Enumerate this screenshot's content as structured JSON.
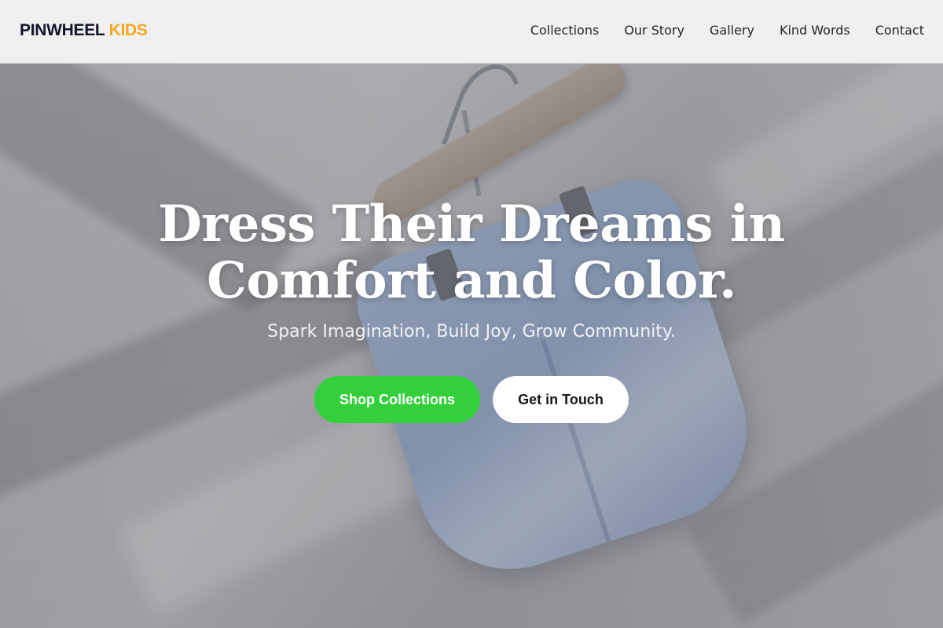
{
  "brand": {
    "name": "PINWHEEL",
    "accent": "KIDS"
  },
  "nav": {
    "items": [
      {
        "label": "Collections"
      },
      {
        "label": "Our Story"
      },
      {
        "label": "Gallery"
      },
      {
        "label": "Kind Words"
      },
      {
        "label": "Contact"
      }
    ]
  },
  "hero": {
    "headline_line1": "Dress Their Dreams in",
    "headline_line2": "Comfort and Color.",
    "subheadline": "Spark Imagination, Build Joy, Grow Community.",
    "primary_cta": "Shop Collections",
    "secondary_cta": "Get in Touch"
  },
  "colors": {
    "brand_text": "#12142a",
    "brand_accent": "#f5a623",
    "primary_button": "#34d03c",
    "secondary_button": "#ffffff"
  }
}
